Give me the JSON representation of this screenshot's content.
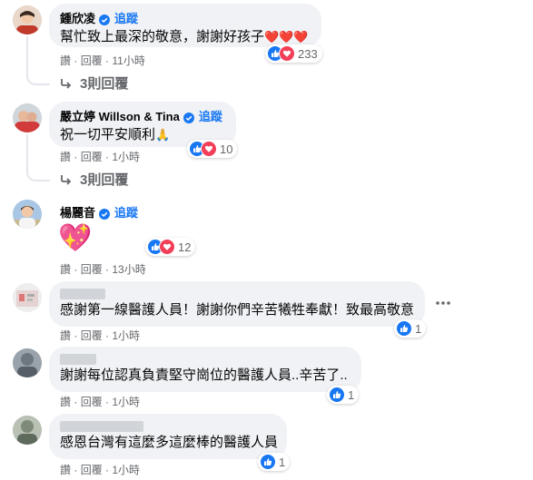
{
  "follow_label": "追蹤",
  "comments": [
    {
      "name": "鍾欣凌",
      "verified": true,
      "text": "幫忙致上最深的敬意，謝謝好孩子",
      "text_emoji": "❤️❤️❤️",
      "reactions": [
        "like",
        "love"
      ],
      "reaction_count": "233",
      "actions": {
        "like": "讚",
        "reply": "回覆",
        "time": "11小時"
      },
      "replies": "3則回覆"
    },
    {
      "name": "嚴立婷 Willson & Tina",
      "verified": true,
      "text": "祝一切平安順利",
      "text_emoji": "🙏",
      "reactions": [
        "like",
        "love"
      ],
      "reaction_count": "10",
      "actions": {
        "like": "讚",
        "reply": "回覆",
        "time": "1小時"
      },
      "replies": "3則回覆"
    },
    {
      "name": "楊麗音",
      "verified": true,
      "text": "",
      "text_emoji": "💖",
      "reactions": [
        "like",
        "love"
      ],
      "reaction_count": "12",
      "actions": {
        "like": "讚",
        "reply": "回覆",
        "time": "13小時"
      },
      "replies": ""
    },
    {
      "name": "",
      "verified": false,
      "text": "感謝第一線醫護人員！謝謝你們辛苦犧牲奉獻！致最高敬意",
      "text_emoji": "",
      "reactions": [
        "like"
      ],
      "reaction_count": "1",
      "actions": {
        "like": "讚",
        "reply": "回覆",
        "time": "1小時"
      },
      "replies": ""
    },
    {
      "name": "",
      "verified": false,
      "text": "謝謝每位認真負責堅守崗位的醫護人員..辛苦了..",
      "text_emoji": "",
      "reactions": [
        "like"
      ],
      "reaction_count": "1",
      "actions": {
        "like": "讚",
        "reply": "回覆",
        "time": "1小時"
      },
      "replies": ""
    },
    {
      "name": "",
      "verified": false,
      "text": "感恩台灣有這麼多這麼棒的醫護人員",
      "text_emoji": "",
      "reactions": [
        "like"
      ],
      "reaction_count": "1",
      "actions": {
        "like": "讚",
        "reply": "回覆",
        "time": "1小時"
      },
      "replies": ""
    }
  ],
  "colors": {
    "accent": "#1877f2",
    "love": "#f33e58",
    "bubble": "#f0f2f5",
    "meta": "#65676b"
  }
}
